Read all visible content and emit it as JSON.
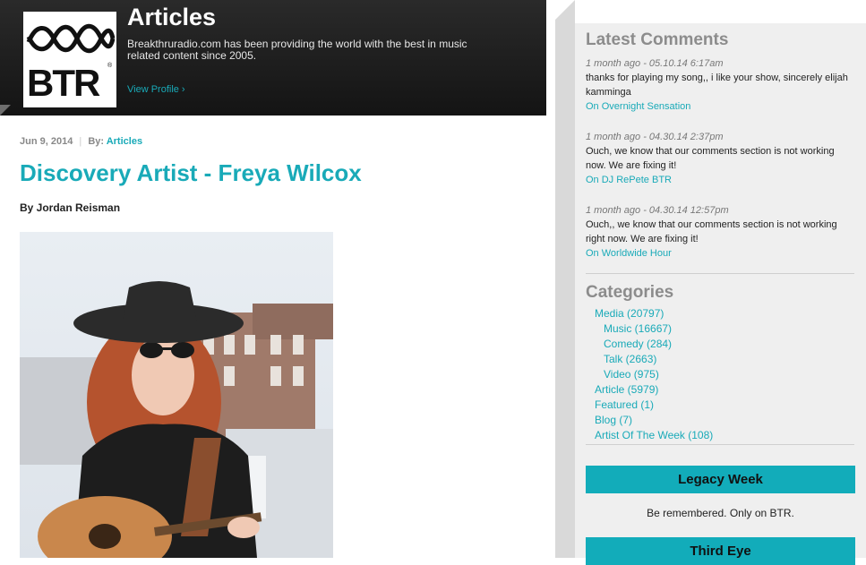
{
  "header": {
    "title": "Articles",
    "description": "Breakthruradio.com has been providing the world with the best in music related content since 2005.",
    "view_profile": "View Profile ›",
    "logo_text": "BTR",
    "logo_mark": "®"
  },
  "article": {
    "date": "Jun 9, 2014",
    "separator": "|",
    "by_label": "By:",
    "category": "Articles",
    "title": "Discovery Artist - Freya Wilcox",
    "byline": "By Jordan Reisman"
  },
  "sidebar": {
    "latest_comments_heading": "Latest Comments",
    "comments": [
      {
        "meta": "1 month ago - 05.10.14 6:17am",
        "text": "thanks for playing my song,, i like your show, sincerely elijah kamminga",
        "on": "On Overnight Sensation"
      },
      {
        "meta": "1 month ago - 04.30.14 2:37pm",
        "text": "Ouch, we know that our comments section is not working now. We are fixing it!",
        "on": "On DJ RePete BTR"
      },
      {
        "meta": "1 month ago - 04.30.14 12:57pm",
        "text": "Ouch,, we know that our comments section is not working right now. We are fixing it!",
        "on": "On Worldwide Hour"
      }
    ],
    "categories_heading": "Categories",
    "categories": [
      {
        "label": "Media (20797)",
        "sub": false
      },
      {
        "label": "Music (16667)",
        "sub": true
      },
      {
        "label": "Comedy (284)",
        "sub": true
      },
      {
        "label": "Talk (2663)",
        "sub": true
      },
      {
        "label": "Video (975)",
        "sub": true
      },
      {
        "label": "Article (5979)",
        "sub": false
      },
      {
        "label": "Featured (1)",
        "sub": false
      },
      {
        "label": "Blog (7)",
        "sub": false
      },
      {
        "label": "Artist Of The Week (108)",
        "sub": false
      }
    ],
    "promo1_title": "Legacy Week",
    "promo1_text": "Be remembered. Only on BTR.",
    "promo2_title": "Third Eye"
  },
  "colors": {
    "accent": "#19aab8",
    "promo_bar": "#12acba",
    "header_bg": "#1c1c1c",
    "sidebar_bg": "#efefef"
  }
}
